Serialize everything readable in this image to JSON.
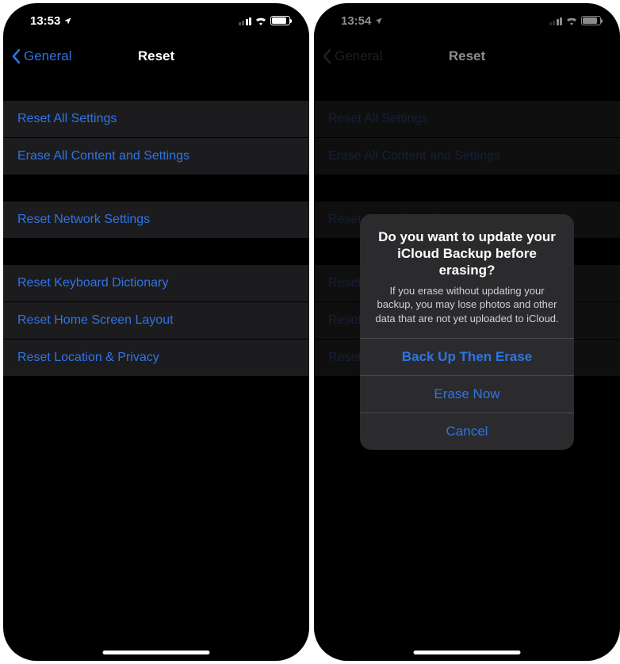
{
  "screenLeft": {
    "status": {
      "time": "13:53"
    },
    "nav": {
      "back": "General",
      "title": "Reset"
    },
    "groups": [
      [
        "Reset All Settings",
        "Erase All Content and Settings"
      ],
      [
        "Reset Network Settings"
      ],
      [
        "Reset Keyboard Dictionary",
        "Reset Home Screen Layout",
        "Reset Location & Privacy"
      ]
    ]
  },
  "screenRight": {
    "status": {
      "time": "13:54"
    },
    "nav": {
      "back": "General",
      "title": "Reset"
    },
    "groups": [
      [
        "Reset All Settings",
        "Erase All Content and Settings"
      ],
      [
        "Reset Network Settings"
      ],
      [
        "Reset Keyboard Dictionary",
        "Reset Home Screen Layout",
        "Reset Location & Privacy"
      ]
    ],
    "alert": {
      "title": "Do you want to update your iCloud Backup before erasing?",
      "message": "If you erase without updating your backup, you may lose photos and other data that are not yet uploaded to iCloud.",
      "buttons": {
        "primary": "Back Up Then Erase",
        "secondary": "Erase Now",
        "cancel": "Cancel"
      }
    }
  }
}
